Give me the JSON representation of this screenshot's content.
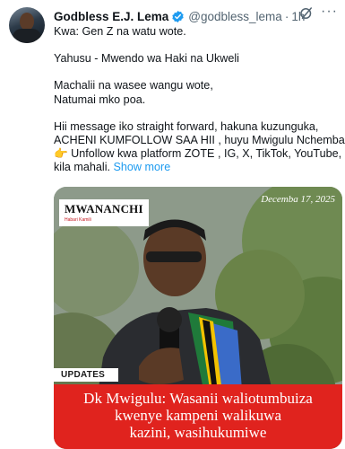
{
  "tweet": {
    "author_name": "Godbless E.J. Lema",
    "author_handle": "@godbless_lema",
    "separator": "·",
    "time": "1h",
    "more_icon": "more-icon",
    "grok_icon": "grok-icon",
    "verified_color": "#1d9bf0",
    "lines": [
      "Kwa: Gen Z na watu wote.",
      "",
      "Yahusu - Mwendo wa Haki na Ukweli",
      "",
      "Machalii na wasee wangu wote,",
      "Natumai mko poa.",
      "",
      "Hii message iko straight forward, hakuna kuzunguka,",
      " ACHENI KUMFOLLOW SAA HII , huyu Mwigulu Nchemba.",
      "👉 Unfollow kwa platform ZOTE , IG, X, TikTok, YouTube,"
    ],
    "last_line": "kila mahali.",
    "show_more": "Show more"
  },
  "media": {
    "logo": "MWANANCHI",
    "logo_sub": "Habari Kamili",
    "date": "Decemba 17, 2025",
    "tag": "UPDATES",
    "headline_lines": [
      "Dk Mwigulu: Wasanii waliotumbuiza",
      "kwenye kampeni walikuwa",
      "kazini, wasihukumiwe"
    ],
    "banner_color": "#e0231e"
  }
}
